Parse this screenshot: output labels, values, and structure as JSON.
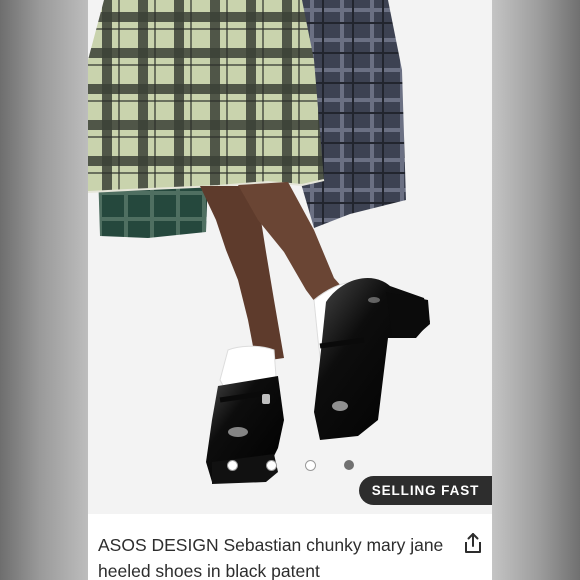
{
  "product": {
    "badge": "SELLING FAST",
    "title": "ASOS DESIGN Sebastian chunky mary jane heeled shoes in black patent"
  },
  "carousel": {
    "dot_count": 4,
    "active_index": 3
  },
  "icons": {
    "share": "share-icon"
  },
  "colors": {
    "badge_bg": "#2d2d2d",
    "text": "#2d2d2d",
    "active_dot": "#707070"
  }
}
